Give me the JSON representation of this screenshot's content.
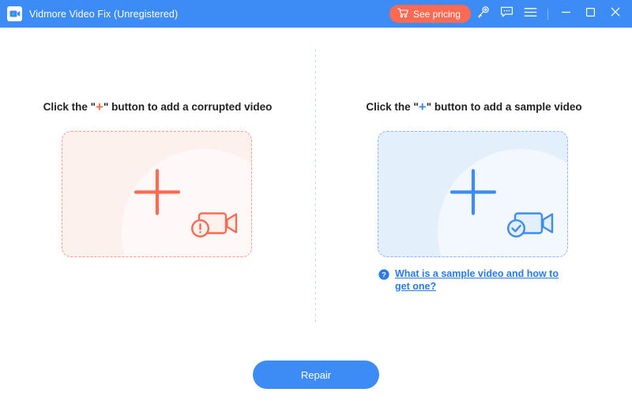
{
  "window": {
    "title": "Vidmore Video Fix (Unregistered)",
    "logo_icon": "video-camera-logo",
    "header_bg": "#3d8bf5"
  },
  "titlebar": {
    "pricing_label": "See pricing",
    "pricing_icon": "shopping-cart-icon",
    "pricing_bg": "#fd6a51",
    "key_icon": "key-icon",
    "feedback_icon": "chat-bubble-icon",
    "menu_icon": "hamburger-menu-icon",
    "minimize_icon": "minimize-icon",
    "maximize_icon": "maximize-icon",
    "close_icon": "close-icon"
  },
  "left_panel": {
    "heading_before": "Click the \"",
    "heading_plus": "+",
    "heading_after": "\" button to add a corrupted video",
    "plus_color": "#fd6a51",
    "zone_fill": "#fdf1ee",
    "zone_border": "#fb9b86",
    "add_plus_icon": "plus-icon",
    "status_icon": "video-camera-error-icon"
  },
  "right_panel": {
    "heading_before": "Click the \"",
    "heading_plus": "+",
    "heading_after": "\" button to add a sample video",
    "plus_color": "#3d8bf5",
    "zone_fill": "#e4effc",
    "zone_border": "#8ab6f7",
    "add_plus_icon": "plus-icon",
    "status_icon": "video-camera-check-icon",
    "help_icon": "question-mark-icon",
    "help_text": "What is a sample video and how to get one?"
  },
  "footer": {
    "repair_label": "Repair",
    "repair_bg": "#3d8bf5"
  }
}
